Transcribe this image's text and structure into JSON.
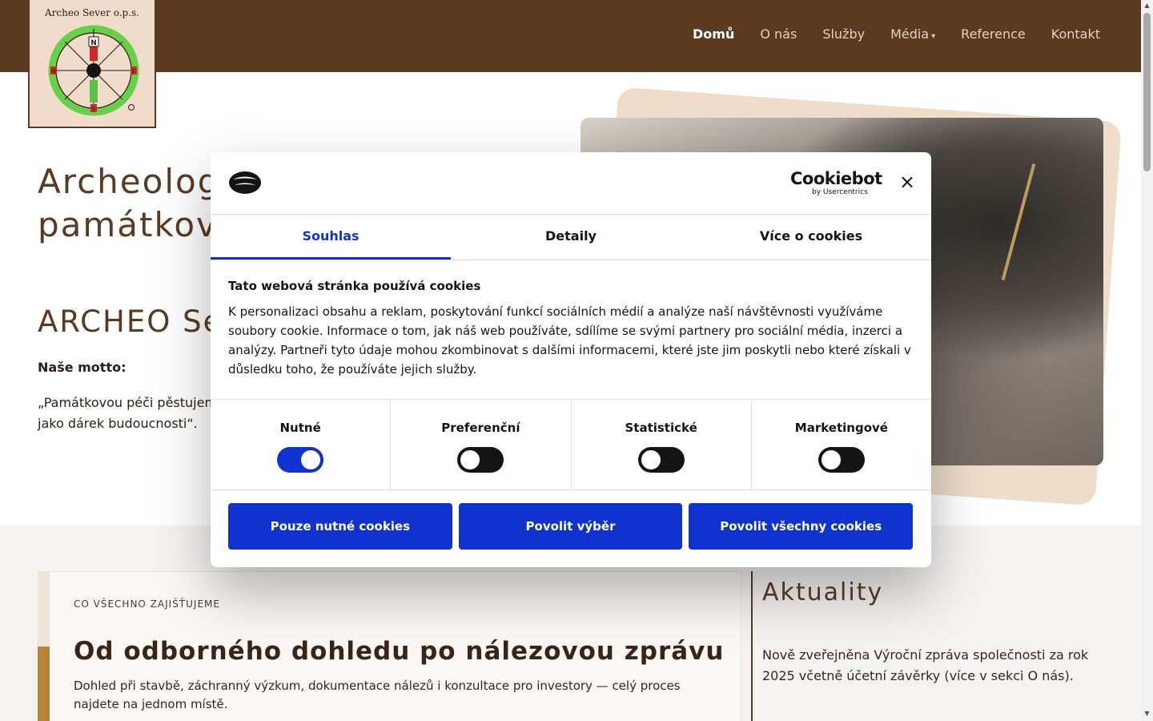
{
  "logo": {
    "text": "Archeo Sever o.p.s."
  },
  "nav": {
    "items": [
      {
        "label": "Domů"
      },
      {
        "label": "O nás"
      },
      {
        "label": "Služby"
      },
      {
        "label": "Média"
      },
      {
        "label": "Reference"
      },
      {
        "label": "Kontakt"
      }
    ]
  },
  "hero": {
    "title_line1": "Archeolog",
    "title_line2": "památkov",
    "subtitle": "ARCHEO Se",
    "motto_label": "Naše motto:",
    "motto_text": "„Památkovou péči pěstujem jako dárek budoucnosti“."
  },
  "section": {
    "kicker": "CO VŠECHNO ZAJIŠŤUJEME",
    "title": "Od odborného dohledu po nálezovou zprávu",
    "text": "Dohled při stavbě, záchranný výzkum, dokumentace nálezů i konzultace pro investory — celý proces najdete na jednom místě."
  },
  "news": {
    "title": "Aktuality",
    "text": "Nově zveřejněna Výroční zpráva společnosti za rok 2025 včetně účetní závěrky (více v sekci O nás)."
  },
  "cookie": {
    "brand_name": "Cookiebot",
    "brand_sub": "by Usercentrics",
    "close_label": "×",
    "tabs": [
      {
        "label": "Souhlas"
      },
      {
        "label": "Detaily"
      },
      {
        "label": "Více o cookies"
      }
    ],
    "heading": "Tato webová stránka používá cookies",
    "body": "K personalizaci obsahu a reklam, poskytování funkcí sociálních médií a analýze naší návštěvnosti využíváme soubory cookie. Informace o tom, jak náš web používáte, sdílíme se svými partnery pro sociální média, inzerci a analýzy. Partneři tyto údaje mohou zkombinovat s dalšími informacemi, které jste jim poskytli nebo které získali v důsledku toho, že používáte jejich služby.",
    "categories": [
      {
        "label": "Nutné",
        "enabled": true
      },
      {
        "label": "Preferenční",
        "enabled": false
      },
      {
        "label": "Statistické",
        "enabled": false
      },
      {
        "label": "Marketingové",
        "enabled": false
      }
    ],
    "buttons": {
      "necessary": "Pouze nutné cookies",
      "selection": "Povolit výběr",
      "all": "Povolit všechny cookies"
    },
    "accent_color": "#1032cf"
  },
  "colors": {
    "header_bg": "#5a3a20",
    "logo_bg": "#f1dccb",
    "section_bg": "#f5f3f2"
  }
}
